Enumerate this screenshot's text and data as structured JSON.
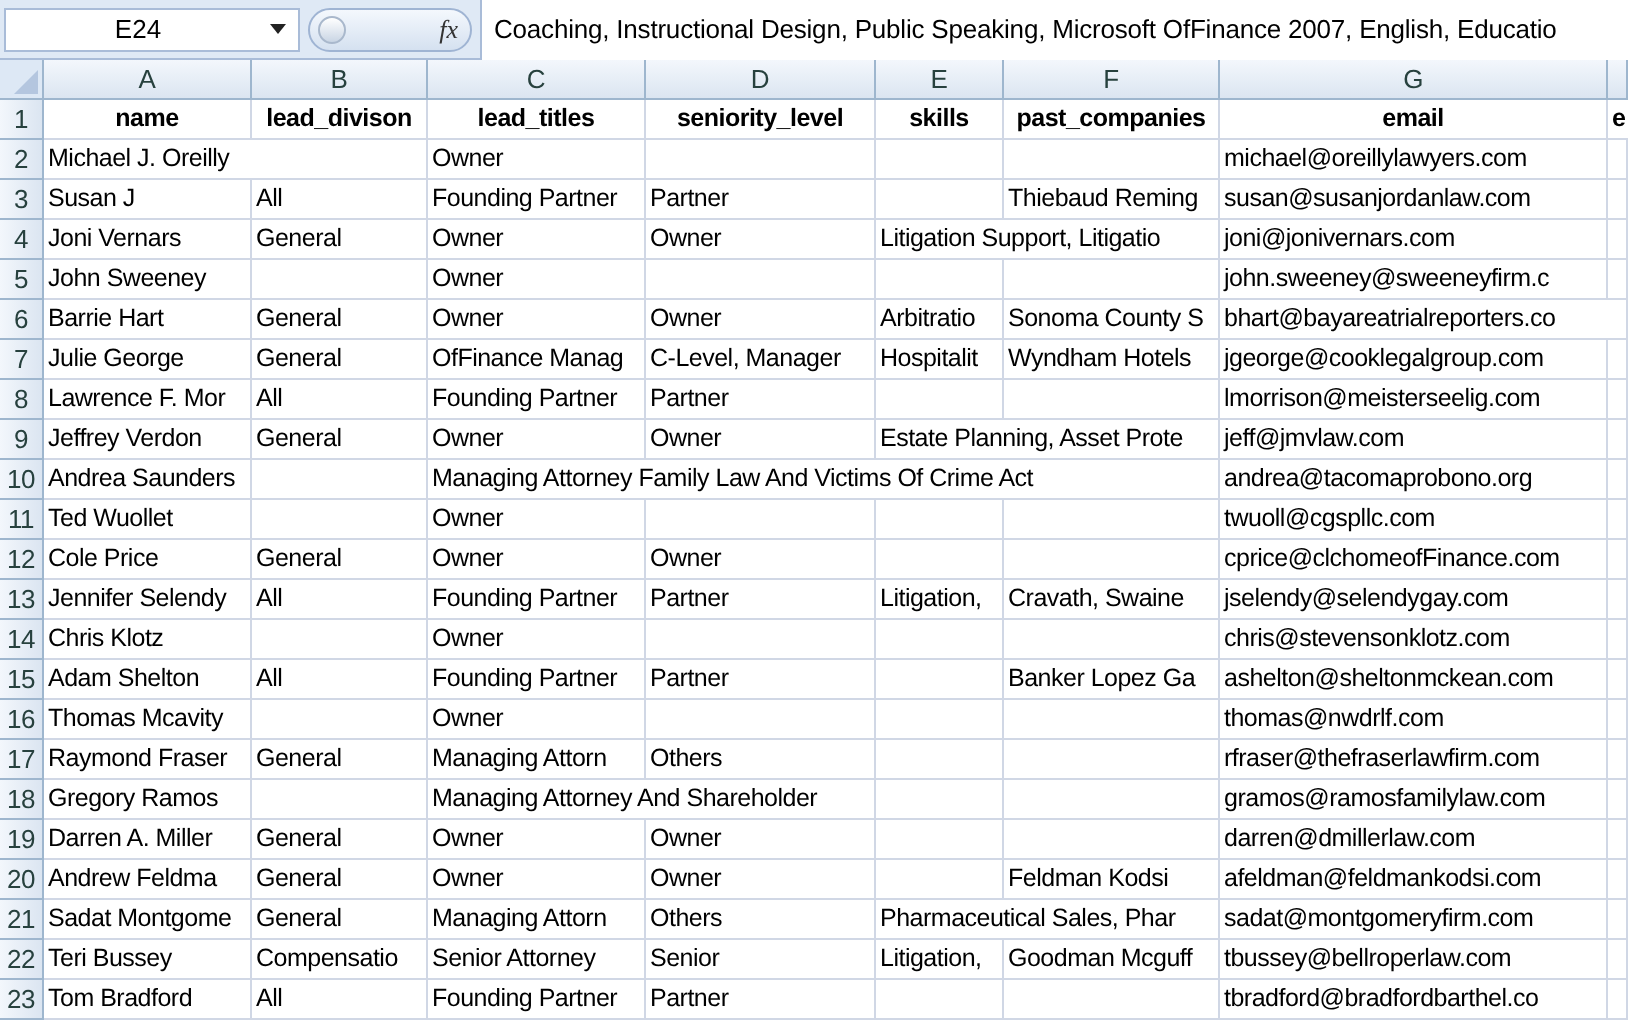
{
  "formula_bar": {
    "name_box": "E24",
    "function_label": "fx",
    "formula": "Coaching, Instructional Design, Public Speaking, Microsoft OfFinance 2007, English, Educatio"
  },
  "columns": [
    "A",
    "B",
    "C",
    "D",
    "E",
    "F",
    "G"
  ],
  "header_row": {
    "number": "1",
    "cells": [
      "name",
      "lead_divison",
      "lead_titles",
      "seniority_level",
      "skills",
      "past_companies",
      "email",
      "e"
    ]
  },
  "rows": [
    {
      "number": "2",
      "cells": [
        "Michael J. Oreilly",
        null,
        "Owner",
        null,
        null,
        null,
        "michael@oreillylawyers.com",
        null
      ]
    },
    {
      "number": "3",
      "cells": [
        "Susan J",
        "All",
        "Founding Partner",
        "Partner",
        null,
        "Thiebaud Reming",
        "susan@susanjordanlaw.com",
        null
      ]
    },
    {
      "number": "4",
      "cells": [
        "Joni Vernars",
        "General",
        "Owner",
        "Owner",
        "Litigation Support, Litigatio",
        null,
        "joni@jonivernars.com",
        null
      ]
    },
    {
      "number": "5",
      "cells": [
        "John Sweeney",
        null,
        "Owner",
        null,
        null,
        null,
        "john.sweeney@sweeneyfirm.c",
        null
      ]
    },
    {
      "number": "6",
      "cells": [
        "Barrie Hart",
        "General",
        "Owner",
        "Owner",
        "Arbitratio",
        "Sonoma County S",
        "bhart@bayareatrialreporters.co",
        null
      ]
    },
    {
      "number": "7",
      "cells": [
        "Julie George",
        "General",
        "OfFinance Manag",
        "C-Level, Manager",
        "Hospitalit",
        "Wyndham Hotels",
        "jgeorge@cooklegalgroup.com",
        null
      ]
    },
    {
      "number": "8",
      "cells": [
        "Lawrence F. Mor",
        "All",
        "Founding Partner",
        "Partner",
        null,
        null,
        "lmorrison@meisterseelig.com",
        null
      ]
    },
    {
      "number": "9",
      "cells": [
        "Jeffrey Verdon",
        "General",
        "Owner",
        "Owner",
        "Estate Planning, Asset Prote",
        null,
        "jeff@jmvlaw.com",
        null
      ]
    },
    {
      "number": "10",
      "cells": [
        "Andrea Saunders",
        null,
        "Managing Attorney Family Law And Victims Of Crime Act",
        null,
        null,
        null,
        "andrea@tacomaprobono.org",
        null
      ]
    },
    {
      "number": "11",
      "cells": [
        "Ted Wuollet",
        null,
        "Owner",
        null,
        null,
        null,
        "twuoll@cgspllc.com",
        null
      ]
    },
    {
      "number": "12",
      "cells": [
        "Cole Price",
        "General",
        "Owner",
        "Owner",
        null,
        null,
        "cprice@clchomeofFinance.com",
        null
      ]
    },
    {
      "number": "13",
      "cells": [
        "Jennifer Selendy",
        "All",
        "Founding Partner",
        "Partner",
        "Litigation,",
        "Cravath, Swaine",
        "jselendy@selendygay.com",
        null
      ]
    },
    {
      "number": "14",
      "cells": [
        "Chris Klotz",
        null,
        "Owner",
        null,
        null,
        null,
        "chris@stevensonklotz.com",
        null
      ]
    },
    {
      "number": "15",
      "cells": [
        "Adam Shelton",
        "All",
        "Founding Partner",
        "Partner",
        null,
        "Banker Lopez Ga",
        "ashelton@sheltonmckean.com",
        null
      ]
    },
    {
      "number": "16",
      "cells": [
        "Thomas Mcavity",
        null,
        "Owner",
        null,
        null,
        null,
        "thomas@nwdrlf.com",
        null
      ]
    },
    {
      "number": "17",
      "cells": [
        "Raymond Fraser",
        "General",
        "Managing Attorn",
        "Others",
        null,
        null,
        "rfraser@thefraserlawfirm.com",
        null
      ]
    },
    {
      "number": "18",
      "cells": [
        "Gregory Ramos",
        null,
        "Managing Attorney And Shareholder",
        null,
        null,
        null,
        "gramos@ramosfamilylaw.com",
        null
      ]
    },
    {
      "number": "19",
      "cells": [
        "Darren A. Miller",
        "General",
        "Owner",
        "Owner",
        null,
        null,
        "darren@dmillerlaw.com",
        null
      ]
    },
    {
      "number": "20",
      "cells": [
        "Andrew Feldma",
        "General",
        "Owner",
        "Owner",
        null,
        "Feldman Kodsi",
        "afeldman@feldmankodsi.com",
        null
      ]
    },
    {
      "number": "21",
      "cells": [
        "Sadat Montgome",
        "General",
        "Managing Attorn",
        "Others",
        "Pharmaceutical Sales, Phar",
        null,
        "sadat@montgomeryfirm.com",
        null
      ]
    },
    {
      "number": "22",
      "cells": [
        "Teri Bussey",
        "Compensatio",
        "Senior Attorney",
        "Senior",
        "Litigation,",
        "Goodman Mcguff",
        "tbussey@bellroperlaw.com",
        null
      ]
    },
    {
      "number": "23",
      "cells": [
        "Tom Bradford",
        "All",
        "Founding Partner",
        "Partner",
        null,
        null,
        "tbradford@bradfordbarthel.co",
        null
      ]
    }
  ]
}
